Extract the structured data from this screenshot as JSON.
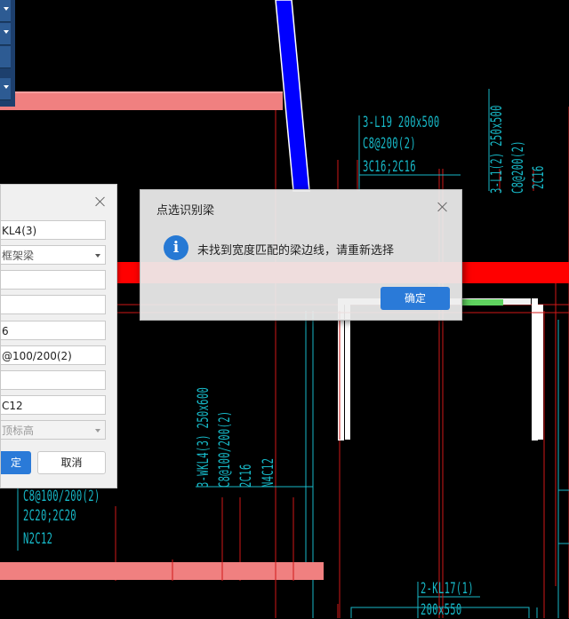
{
  "left_dialog": {
    "fields": [
      "KL4(3)",
      "框架梁",
      "",
      "",
      "6",
      "@100/200(2)",
      "",
      "C12",
      "顶标高"
    ],
    "confirm_label": "定",
    "cancel_label": "取消",
    "close_icon": "close-icon"
  },
  "message_dialog": {
    "title": "点选识别梁",
    "message": "未找到宽度匹配的梁边线，请重新选择",
    "ok_label": "确定",
    "icon": "info-icon",
    "icon_glyph": "i"
  },
  "cad_annotations": {
    "l19": [
      "3-L19 200x500",
      "C8@200(2)",
      "3C16;2C16"
    ],
    "l1": [
      "3-L1(2) 250x500",
      "C8@200(2)",
      "2C16"
    ],
    "wkl4": [
      "3-WKL4(3) 250x600",
      "C8@100/200(2)",
      "2C16",
      "N4C12"
    ],
    "left_lower": [
      "C8@100/200(2)",
      "2C20;2C20",
      "N2C12"
    ],
    "kl17": [
      "2-KL17(1)",
      "200x550"
    ]
  },
  "colors": {
    "cad_text": "#17b9c8",
    "beam_red": "#ff0000",
    "beam_pink": "#f08080",
    "column_blue": "#0000ff",
    "green_segment": "#5fd35f",
    "accent_button": "#2a7ad8"
  }
}
